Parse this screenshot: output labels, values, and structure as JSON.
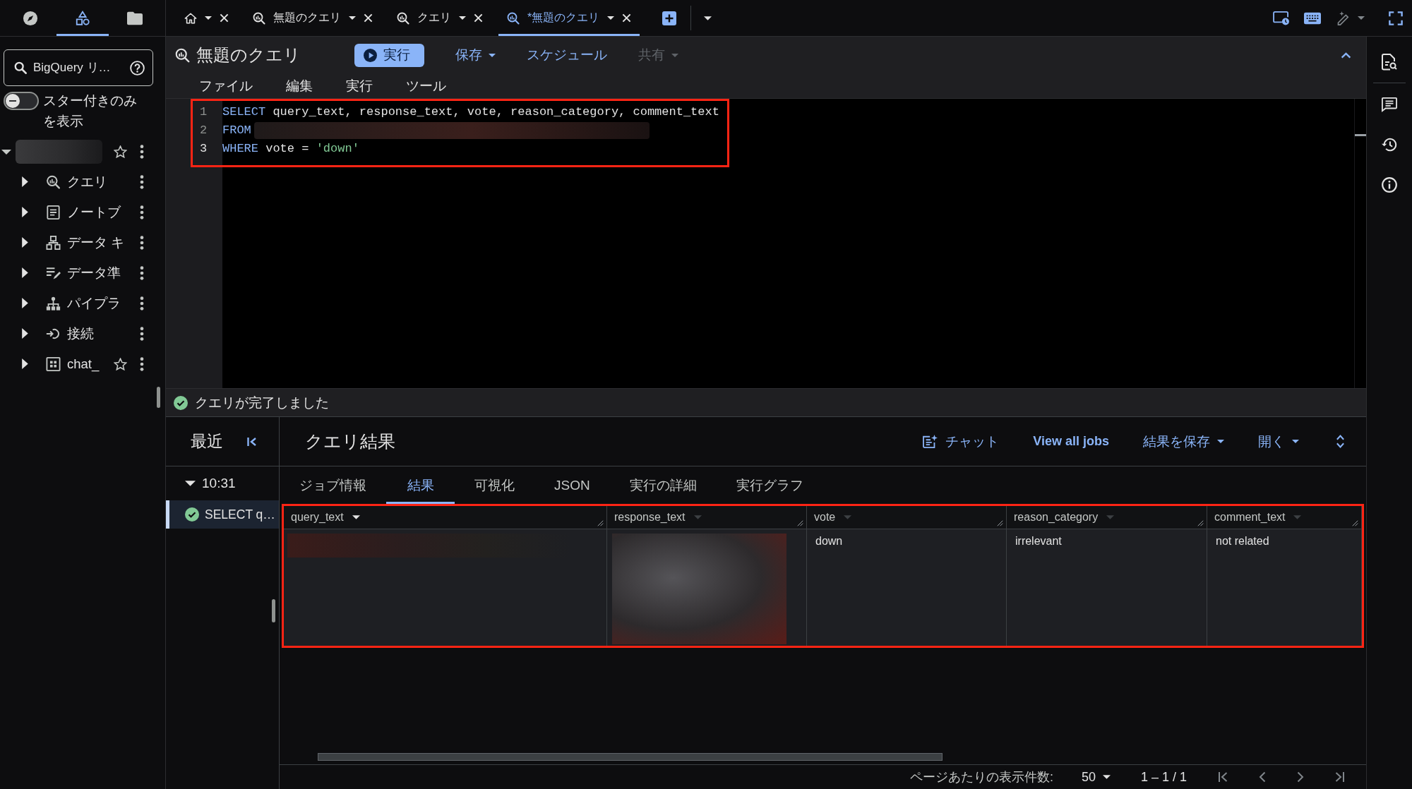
{
  "rail": [
    {
      "kind": "compass",
      "selected": false
    },
    {
      "kind": "explorer",
      "selected": true
    },
    {
      "kind": "folder",
      "selected": false
    }
  ],
  "sidebar": {
    "search": {
      "placeholder": "BigQuery リ…"
    },
    "starred_only": {
      "label": "スター付きのみを表示",
      "on": false
    },
    "project": {
      "expanded": true,
      "starred": false,
      "children": [
        {
          "kind": "queries",
          "label": "クエリ",
          "expanded": false,
          "starred": false
        },
        {
          "kind": "notebooks",
          "label": "ノートブ",
          "expanded": false,
          "starred": false
        },
        {
          "kind": "canvases",
          "label": "データ キ",
          "expanded": false,
          "starred": false
        },
        {
          "kind": "data_prep",
          "label": "データ準",
          "expanded": false,
          "starred": false
        },
        {
          "kind": "pipelines",
          "label": "パイプラ",
          "expanded": false,
          "starred": false
        },
        {
          "kind": "connections",
          "label": "接続",
          "expanded": false,
          "starred": false
        },
        {
          "kind": "dataset",
          "label": "chat_",
          "expanded": false,
          "starred": false
        }
      ]
    }
  },
  "tabs": [
    {
      "kind": "home",
      "selected": false
    },
    {
      "kind": "query",
      "label": "無題のクエリ",
      "selected": false
    },
    {
      "kind": "query",
      "label": "クエリ",
      "selected": false
    },
    {
      "kind": "query",
      "label": "*無題のクエリ",
      "selected": true
    }
  ],
  "query": {
    "title": "無題のクエリ",
    "actions": [
      {
        "kind": "primary",
        "label": "実行",
        "disabled": false
      },
      {
        "kind": "menu",
        "label": "保存",
        "disabled": false
      },
      {
        "kind": "plain",
        "label": "スケジュール",
        "disabled": false
      },
      {
        "kind": "menu",
        "label": "共有",
        "disabled": true
      }
    ],
    "menu": [
      "ファイル",
      "編集",
      "実行",
      "ツール"
    ]
  },
  "editor": {
    "highlighted": true,
    "lines": [
      {
        "number": "1",
        "current": false,
        "tokens": [
          {
            "kind": "keyword",
            "text": "SELECT"
          },
          {
            "kind": "plain",
            "text": " query_text, response_text, vote, reason_category, comment_text"
          }
        ]
      },
      {
        "number": "2",
        "current": false,
        "tokens": [
          {
            "kind": "keyword",
            "text": "FROM"
          },
          {
            "kind": "redacted"
          }
        ]
      },
      {
        "number": "3",
        "current": true,
        "tokens": [
          {
            "kind": "keyword",
            "text": "WHERE"
          },
          {
            "kind": "plain",
            "text": " vote = "
          },
          {
            "kind": "string",
            "text": "'down'"
          }
        ]
      }
    ]
  },
  "status": {
    "success": true,
    "message": "クエリが完了しました"
  },
  "history": {
    "title": "最近",
    "groups": [
      {
        "time": "10:31",
        "expanded": true,
        "jobs": [
          {
            "label": "SELECT q…",
            "success": true,
            "selected": true
          }
        ]
      }
    ]
  },
  "results": {
    "title": "クエリ結果",
    "actions": [
      {
        "kind": "chat",
        "label": "チャット"
      },
      {
        "kind": "link",
        "label": "View all jobs"
      },
      {
        "kind": "menu",
        "label": "結果を保存"
      },
      {
        "kind": "menu",
        "label": "開く"
      }
    ],
    "tabs": [
      {
        "label": "ジョブ情報",
        "selected": false
      },
      {
        "label": "結果",
        "selected": true
      },
      {
        "label": "可視化",
        "selected": false
      },
      {
        "label": "JSON",
        "selected": false
      },
      {
        "label": "実行の詳細",
        "selected": false
      },
      {
        "label": "実行グラフ",
        "selected": false
      }
    ],
    "table": {
      "highlighted": true,
      "columns": [
        {
          "name": "query_text",
          "focused": true
        },
        {
          "name": "response_text",
          "focused": false
        },
        {
          "name": "vote",
          "focused": false
        },
        {
          "name": "reason_category",
          "focused": false
        },
        {
          "name": "comment_text",
          "focused": false
        }
      ],
      "rows": [
        {
          "cells": [
            {
              "kind": "redacted_line"
            },
            {
              "kind": "redacted_block"
            },
            {
              "kind": "text",
              "text": "down"
            },
            {
              "kind": "text",
              "text": "irrelevant"
            },
            {
              "kind": "text",
              "text": "not related"
            }
          ]
        }
      ]
    },
    "pagination": {
      "page_size_label": "ページあたりの表示件数:",
      "page_size": "50",
      "range": "1 – 1 / 1",
      "nav": [
        {
          "kind": "first",
          "disabled": true
        },
        {
          "kind": "previous",
          "disabled": true
        },
        {
          "kind": "next",
          "disabled": true
        },
        {
          "kind": "last",
          "disabled": true
        }
      ]
    }
  }
}
